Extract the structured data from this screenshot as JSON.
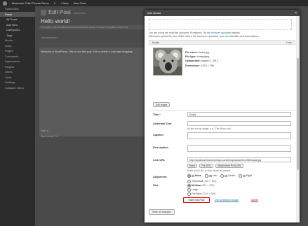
{
  "adminbar": {
    "site_name": "Maximum Child Theme Demo",
    "comments": "0",
    "new_label": "+ New",
    "view_post": "View Post"
  },
  "sidebar": {
    "items": [
      {
        "label": "Dashboard",
        "state": "normal"
      },
      {
        "label": "Posts",
        "state": "active"
      },
      {
        "label": "All Posts",
        "state": "sub"
      },
      {
        "label": "Add New",
        "state": "sub"
      },
      {
        "label": "Categories",
        "state": "sub"
      },
      {
        "label": "Tags",
        "state": "sub"
      },
      {
        "label": "Media",
        "state": "normal"
      },
      {
        "label": "Links",
        "state": "normal"
      },
      {
        "label": "Pages",
        "state": "normal"
      },
      {
        "label": "Comments",
        "state": "normal"
      },
      {
        "label": "Appearance",
        "state": "normal"
      },
      {
        "label": "Plugins",
        "state": "normal"
      },
      {
        "label": "Users",
        "state": "normal"
      },
      {
        "label": "Tools",
        "state": "normal"
      },
      {
        "label": "Settings",
        "state": "normal"
      },
      {
        "label": "Collapse menu",
        "state": "normal"
      }
    ]
  },
  "background": {
    "page_title": "Edit Post",
    "add_new": "Add New",
    "post_title": "Hello world!",
    "permalink": "Permalink: http://localhost/maximum/wp/hello-world/   Change Permalinks   View Post",
    "upload_insert": "Upload/Insert",
    "editor_body": "Welcome to WordPress. This is your first post. Edit or delete it, then start blogging!",
    "path": "Path: p",
    "word_count": "Word count: 14"
  },
  "modal": {
    "title": "Add Media",
    "close_symbol": "×",
    "flash_notice_prefix": "You are using the multi-file uploader. Problems? Try the",
    "flash_notice_link": "browser uploader",
    "flash_notice_suffix": "instead.",
    "max_size": "Maximum upload file size: 8MB. After a file has been uploaded, you can add titles and descriptions.",
    "item_title": "Koala",
    "hide_link": "Hide",
    "file_name_label": "File name:",
    "file_name": "Koala.jpg",
    "file_type_label": "File type:",
    "file_type": "image/jpeg",
    "upload_date_label": "Upload date:",
    "upload_date": "August 3, 2012",
    "dimensions_label": "Dimensions:",
    "dimensions": "1024 × 768",
    "edit_image": "Edit Image",
    "title_label": "Title",
    "title_required": "*",
    "title_value": "Koala",
    "alt_label": "Alternate Text",
    "alt_help": "Alt text for the image, e.g. \"The Mona Lisa\"",
    "caption_label": "Caption",
    "description_label": "Description",
    "link_url_label": "Link URL",
    "link_url_value": "http://localhost/maximum/wp-content/uploads/2012/08/Koala.jpg",
    "btn_none": "None",
    "btn_file_url": "File URL",
    "btn_attachment_url": "Attachment Post URL",
    "link_help": "Enter a link URL or click above for presets.",
    "alignment_label": "Alignment",
    "align_none": "None",
    "align_left": "Left",
    "align_center": "Center",
    "align_right": "Right",
    "size_label": "Size",
    "size_thumbnail": "Thumbnail",
    "size_thumbnail_dim": "(150 × 150)",
    "size_medium": "Medium",
    "size_medium_dim": "(300 × 225)",
    "size_large": "Large",
    "size_full": "Full Size",
    "size_full_dim": "(1024 × 768)",
    "insert_button": "Insert into Post",
    "featured_link": "Use as featured image",
    "delete_link": "Delete",
    "save_all": "Save all changes"
  },
  "colors": {
    "link": "#21759b",
    "highlight_border": "#dd0000",
    "admin_bar": "#2a2a2a"
  }
}
